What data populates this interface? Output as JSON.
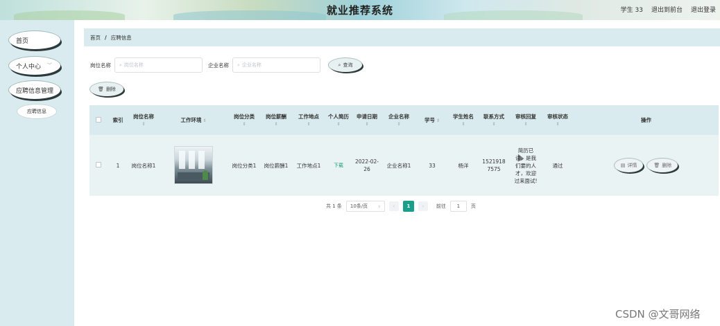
{
  "header": {
    "title": "就业推荐系统",
    "user": "学生 33",
    "back_to_front": "退出到前台",
    "logout": "退出登录"
  },
  "sidebar": {
    "items": [
      {
        "label": "首页"
      },
      {
        "label": "个人中心"
      },
      {
        "label": "应聘信息管理"
      }
    ],
    "sub_items": [
      {
        "label": "应聘信息"
      }
    ]
  },
  "breadcrumb": {
    "home": "首页",
    "separator": "/",
    "current": "应聘信息"
  },
  "search": {
    "job_name_label": "岗位名称",
    "job_name_placeholder": "岗位名称",
    "company_label": "企业名称",
    "company_placeholder": "企业名称",
    "query_button": "查询",
    "delete_button": "删除"
  },
  "table": {
    "headers": {
      "index": "索引",
      "job_name": "岗位名称",
      "environment": "工作环境",
      "category": "岗位分类",
      "salary": "岗位薪酬",
      "location": "工作地点",
      "resume": "个人简历",
      "apply_date": "申请日期",
      "company": "企业名称",
      "student_no": "学号",
      "student_name": "学生姓名",
      "contact": "联系方式",
      "review_reply": "审核回复",
      "review_status": "审核状态",
      "actions": "操作"
    },
    "sort_glyph": "⇕",
    "rows": [
      {
        "index": "1",
        "job_name": "岗位名称1",
        "category": "岗位分类1",
        "salary": "岗位薪酬1",
        "location": "工作地点1",
        "resume": "下载",
        "apply_date": "2022-02-26",
        "company": "企业名称1",
        "student_no": "33",
        "student_name": "杨洋",
        "contact": "15219187575",
        "review_reply": "简历已读，是我们要的人才，欢迎过来面试!",
        "review_status": "通过",
        "detail_label": "详情",
        "delete_label": "删除"
      }
    ]
  },
  "pagination": {
    "total": "共 1 条",
    "page_size": "10条/页",
    "current_page": "1",
    "goto_label": "前往",
    "goto_value": "1",
    "page_unit": "页"
  },
  "watermark": "CSDN @文哥网络",
  "icons": {
    "search": "search-icon",
    "trash": "trash-icon",
    "detail": "detail-icon",
    "chevron": "chevron-down-icon"
  }
}
